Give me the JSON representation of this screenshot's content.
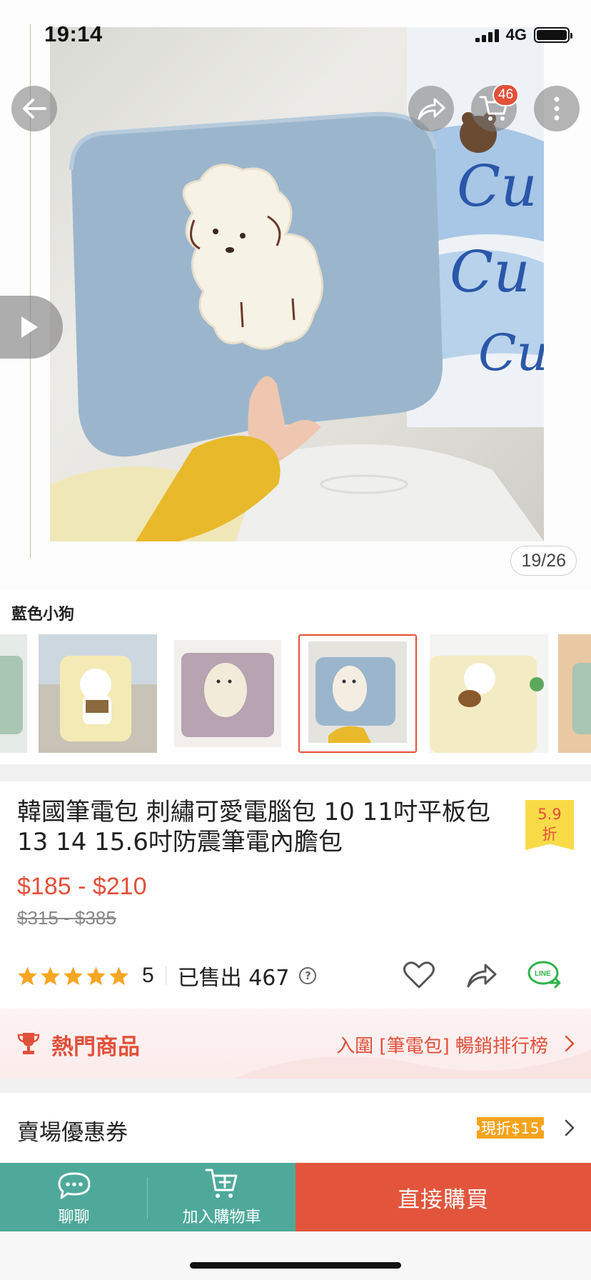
{
  "status_bar": {
    "time": "19:14",
    "network": "4G"
  },
  "header": {
    "cart_count": "46",
    "icons": [
      "back-arrow-icon",
      "share-icon",
      "cart-icon",
      "more-vertical-icon"
    ]
  },
  "gallery": {
    "page_counter": "19/26",
    "current_index": 19,
    "total": 26,
    "play_icon": "play-icon"
  },
  "variant": {
    "selected_label": "藍色小狗",
    "thumbnails": [
      {
        "name": "thumb-green-partial"
      },
      {
        "name": "thumb-yellow-bear"
      },
      {
        "name": "thumb-purple-dog"
      },
      {
        "name": "thumb-blue-dog",
        "selected": true
      },
      {
        "name": "thumb-cream-bear"
      },
      {
        "name": "thumb-partial-right"
      }
    ]
  },
  "product": {
    "title": "韓國筆電包 刺繡可愛電腦包 10 11吋平板包 13 14 15.6吋防震筆電內膽包",
    "discount_line1": "5.9",
    "discount_line2": "折",
    "price": "$185 - $210",
    "original_price": "$315 - $385",
    "rating": "5",
    "stars": 5,
    "sold": "已售出 467",
    "help": "?"
  },
  "hot": {
    "title": "熱門商品",
    "rank_text": "入圍 [筆電包] 暢銷排行榜"
  },
  "coupon": {
    "title": "賣場優惠券",
    "badge": "現折$15"
  },
  "bottom_bar": {
    "chat_label": "聊聊",
    "add_cart_label": "加入購物車",
    "buy_now_label": "直接購買"
  },
  "colors": {
    "accent": "#e2503a",
    "teal": "#4ea99b",
    "star": "#f6a623",
    "discount_yellow": "#f9db48",
    "coupon_orange": "#f7a31c",
    "line_green": "#2fb34a"
  }
}
